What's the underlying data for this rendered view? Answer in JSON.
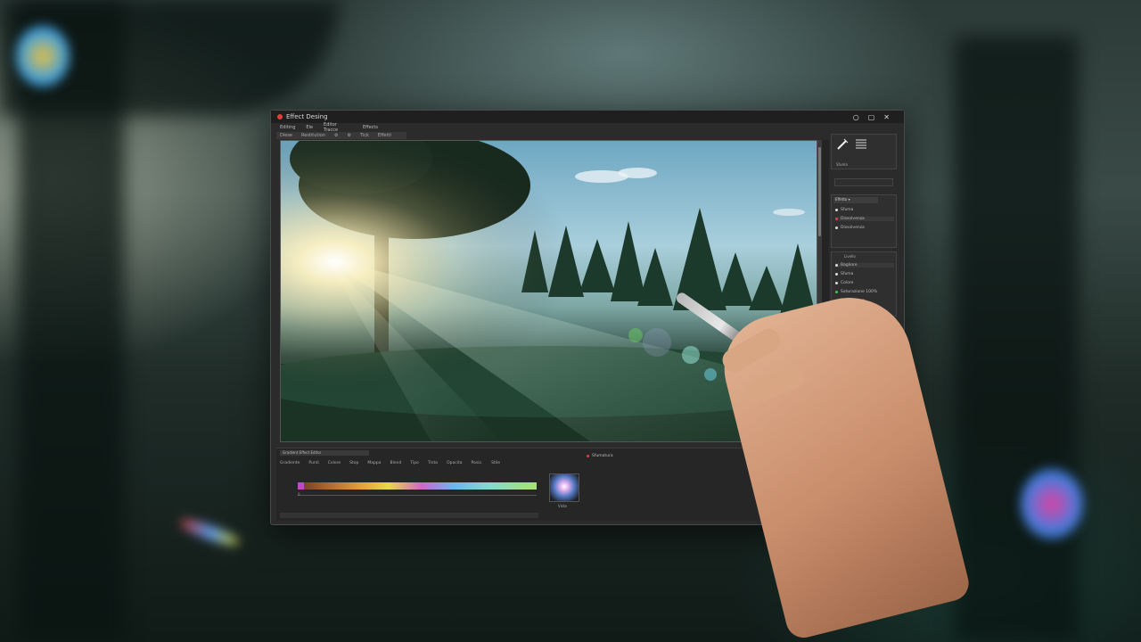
{
  "window": {
    "title": "Effect Desing",
    "controls": [
      "○",
      "▢",
      "✕"
    ]
  },
  "menu": [
    "Editing",
    "Ele",
    "Editor Tracce",
    "Effects"
  ],
  "toolbar": [
    "Diese",
    "Restitution",
    "⚙",
    "⚙",
    "Tick",
    "Effetti"
  ],
  "right_panel": {
    "tool_label": "Sfuma",
    "section1_header": "Effetto ▾",
    "section1_items": [
      {
        "label": "Sfuma",
        "color": "#dddddd"
      },
      {
        "label": "Dissolvenza",
        "color": "#e04040"
      },
      {
        "label": "Dissolvenza",
        "color": "#dddddd"
      }
    ],
    "section2_header": "Livello",
    "section2_items": [
      {
        "label": "Bagliore",
        "color": "#dddddd"
      },
      {
        "label": "Sfuma",
        "color": "#dddddd"
      },
      {
        "label": "Colore",
        "color": "#dddddd"
      },
      {
        "label": "Saturazione 100%",
        "color": "#40c060"
      },
      {
        "label": "Saturazione",
        "color": "#40c060"
      }
    ]
  },
  "bottom_panel": {
    "header": "Gradient Effect Editor",
    "tabs": [
      "Gradiente",
      "Punti",
      "Colore",
      "Stop",
      "Mappa",
      "Blend",
      "Tipo",
      "Tinta",
      "Opacita",
      "Posiz.",
      "Stile"
    ],
    "right_label": "Sfumatura",
    "preview_label": "Vista",
    "gradient_label_start": "0"
  },
  "accents": {
    "brand": "#e0403a",
    "active_row": "#40c060"
  }
}
